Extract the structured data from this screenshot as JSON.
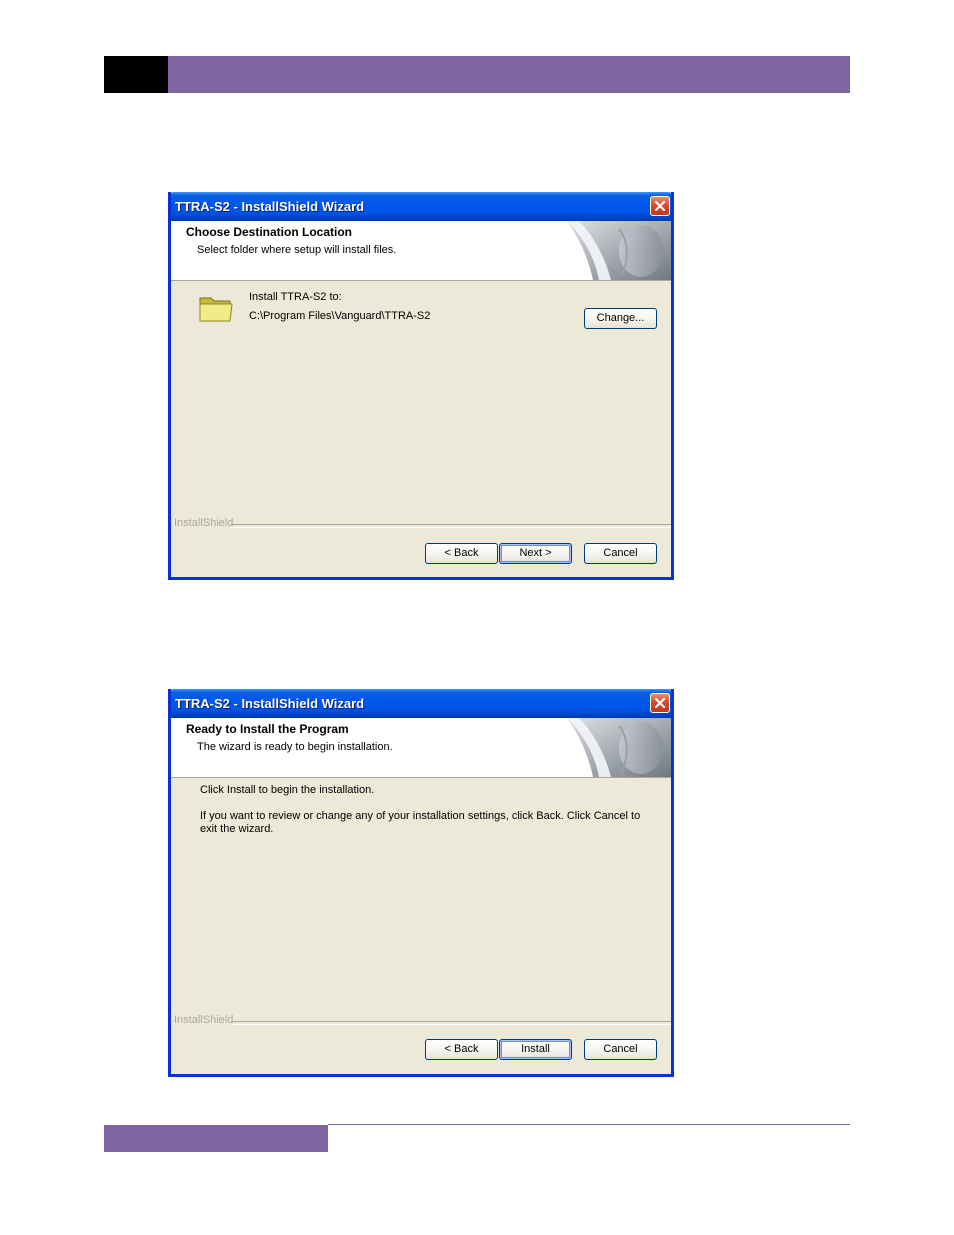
{
  "dialog1": {
    "title": "TTRA-S2 - InstallShield Wizard",
    "header_title": "Choose Destination Location",
    "header_subtitle": "Select folder where setup will install files.",
    "install_to_label": "Install TTRA-S2 to:",
    "install_path": "C:\\Program Files\\Vanguard\\TTRA-S2",
    "change_button": "Change...",
    "brand": "InstallShield",
    "back_button": "< Back",
    "next_button": "Next >",
    "cancel_button": "Cancel"
  },
  "dialog2": {
    "title": "TTRA-S2 - InstallShield Wizard",
    "header_title": "Ready to Install the Program",
    "header_subtitle": "The wizard is ready to begin installation.",
    "line1": "Click Install to begin the installation.",
    "line2": "If you want to review or change any of your installation settings, click Back. Click Cancel to exit the wizard.",
    "brand": "InstallShield",
    "back_button": "< Back",
    "install_button": "Install",
    "cancel_button": "Cancel"
  },
  "colors": {
    "accent_purple": "#8064a2",
    "xp_title_blue": "#0055e5",
    "dialog_face": "#ece9d8"
  }
}
